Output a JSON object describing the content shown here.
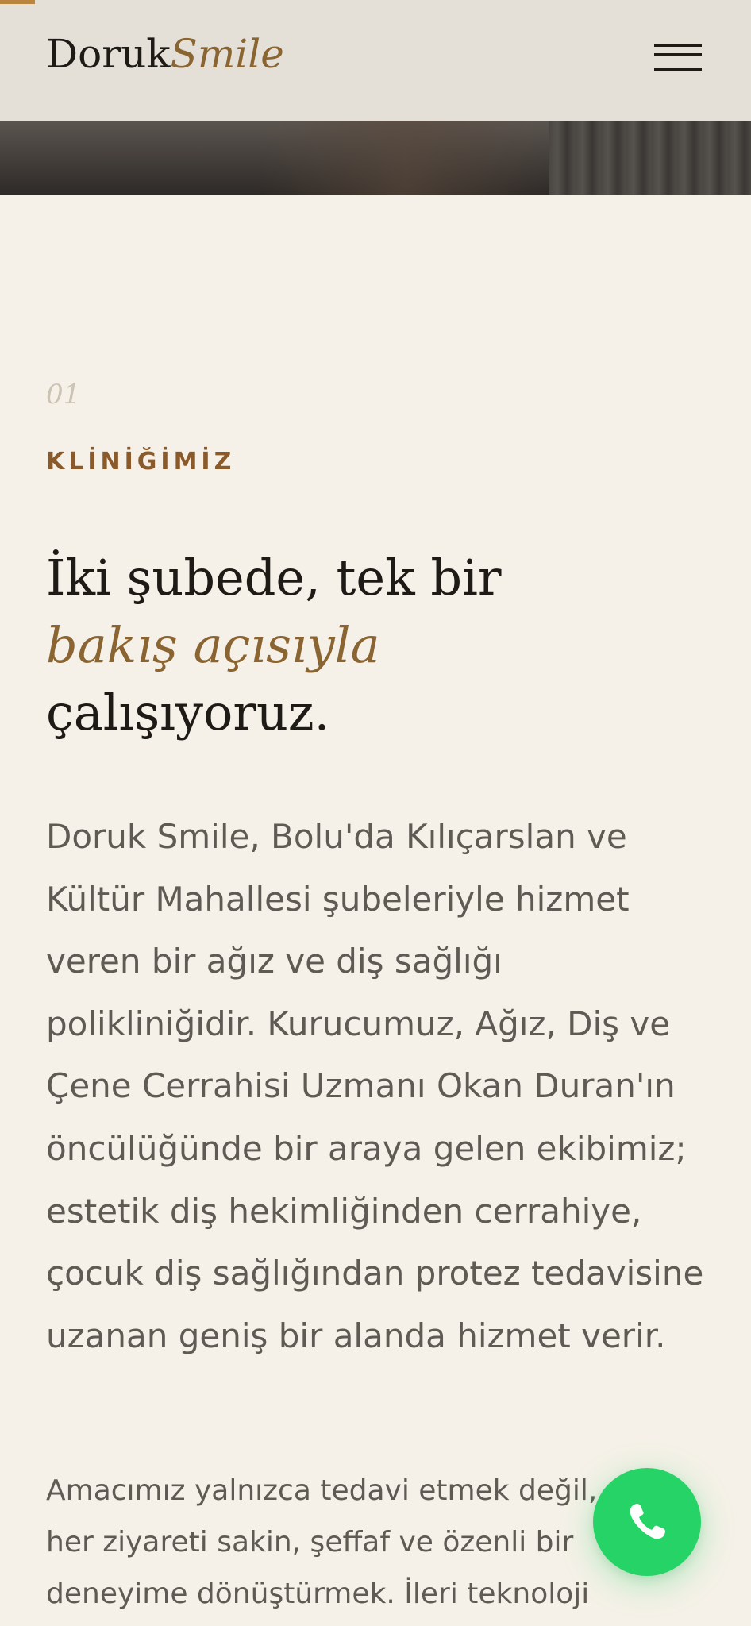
{
  "header": {
    "logo_main": "Doruk",
    "logo_accent": "Smile",
    "menu_label": "Menu",
    "colors": {
      "accent": "#8a6431",
      "background": "#e4e0d8",
      "text": "#1e1b17"
    }
  },
  "section": {
    "number": "01",
    "eyebrow": "KLİNİĞİMİZ",
    "heading": {
      "line1": "İki şubede, tek bir",
      "line2_accent": "bakış açısıyla",
      "line3": "çalışıyoruz."
    },
    "intro": "Doruk Smile, Bolu'da Kılıçarslan ve Kültür Mahallesi şubeleriyle hizmet veren bir ağız ve diş sağlığı polikliniğidir. Kurucumuz, Ağız, Diş ve Çene Cerrahisi Uzmanı Okan Duran'ın öncülüğünde bir araya gelen ekibimiz; estetik diş hekimliğinden cerrahiye, çocuk diş sağlığından protez tedavisine uzanan geniş bir alanda hizmet verir.",
    "secondary": "Amacımız yalnızca tedavi etmek değil, her ziyareti sakin, şeffaf ve özenli bir deneyime dönüştürmek. İleri teknoloji"
  },
  "floating": {
    "whatsapp_icon": "whatsapp-icon",
    "whatsapp_color": "#25d366"
  }
}
